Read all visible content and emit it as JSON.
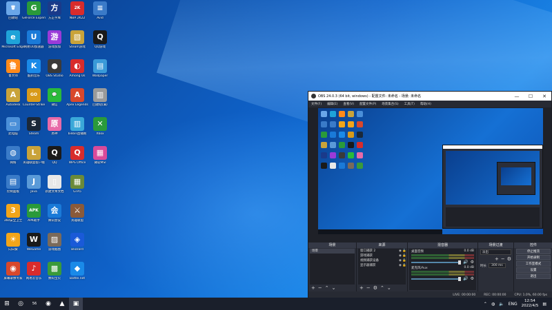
{
  "desktop": {
    "icons": [
      {
        "label": "回收站",
        "glyph": "🗑",
        "color": "#6aa6e8"
      },
      {
        "label": "Microsoft Edge",
        "glyph": "e",
        "color": "#1fa3d8"
      },
      {
        "label": "鲁大师",
        "glyph": "鲁",
        "color": "#ff8a1a"
      },
      {
        "label": "Autodesk",
        "glyph": "A",
        "color": "#c9a33a"
      },
      {
        "label": "此电脑",
        "glyph": "▭",
        "color": "#4a8fd8"
      },
      {
        "label": "网络",
        "glyph": "◍",
        "color": "#3a7bc8"
      },
      {
        "label": "控制面板",
        "glyph": "▤",
        "color": "#3a7bc8"
      },
      {
        "label": "360安全卫士",
        "glyph": "3",
        "color": "#f2a51a"
      },
      {
        "label": "向日葵",
        "glyph": "☀",
        "color": "#f2a51a"
      },
      {
        "label": "屏幕录像专家",
        "glyph": "◉",
        "color": "#d8482c"
      },
      {
        "label": "GeForce Experience",
        "glyph": "G",
        "color": "#2a9a3a"
      },
      {
        "label": "网易UU加速器",
        "glyph": "U",
        "color": "#1a7ad8"
      },
      {
        "label": "酷狗音乐",
        "glyph": "K",
        "color": "#1a8ae8"
      },
      {
        "label": "Counter-Strike",
        "glyph": "GO",
        "color": "#d89a1a"
      },
      {
        "label": "Steam",
        "glyph": "S",
        "color": "#1b2838"
      },
      {
        "label": "英雄联盟客户端",
        "glyph": "L",
        "color": "#c9a33a"
      },
      {
        "label": "Java",
        "glyph": "J",
        "color": "#5a9ad8"
      },
      {
        "label": "APK助手",
        "glyph": "APK",
        "color": "#2a9a3a"
      },
      {
        "label": "WeGame",
        "glyph": "W",
        "color": "#1a1a1a"
      },
      {
        "label": "网易云音乐",
        "glyph": "♪",
        "color": "#d82c2c"
      },
      {
        "label": "方正字库",
        "glyph": "方",
        "color": "#1a3a8a"
      },
      {
        "label": "游戏加加",
        "glyph": "游",
        "color": "#9a3ad8"
      },
      {
        "label": "OBS Studio",
        "glyph": "●",
        "color": "#3a3a3a"
      },
      {
        "label": "微信",
        "glyph": "💬",
        "color": "#2aba3a"
      },
      {
        "label": "原神",
        "glyph": "原",
        "color": "#e86aa8"
      },
      {
        "label": "QQ",
        "glyph": "Q",
        "color": "#1a1a1a"
      },
      {
        "label": "新建文本文档",
        "glyph": "▯",
        "color": "#e8e8e8"
      },
      {
        "label": "腾讯会议",
        "glyph": "会",
        "color": "#1a7ad8"
      },
      {
        "label": "游戏截图",
        "glyph": "▨",
        "color": "#7a6a5a"
      },
      {
        "label": "数码宝贝",
        "glyph": "▩",
        "color": "#3a9a3a"
      },
      {
        "label": "NBA 2K22",
        "glyph": "2K",
        "color": "#d82c2c"
      },
      {
        "label": "Steam游戏",
        "glyph": "▧",
        "color": "#c9a33a"
      },
      {
        "label": "Among Us",
        "glyph": "◐",
        "color": "#d82c2c"
      },
      {
        "label": "Apex Legends",
        "glyph": "A",
        "color": "#d8482c"
      },
      {
        "label": "bilibili直播姬",
        "glyph": "▥",
        "color": "#3aa8d8"
      },
      {
        "label": "WPS Office",
        "glyph": "Q",
        "color": "#d82c2c"
      },
      {
        "label": "GTA5",
        "glyph": "▦",
        "color": "#6a8a3a"
      },
      {
        "label": "英雄联盟",
        "glyph": "⚔",
        "color": "#8a5a3a"
      },
      {
        "label": "Blizzard",
        "glyph": "◈",
        "color": "#1a5ad8"
      },
      {
        "label": "Battle.net",
        "glyph": "◆",
        "color": "#1a8ae8"
      },
      {
        "label": "Avid",
        "glyph": "≡",
        "color": "#3a7ac8"
      },
      {
        "label": "QQ游戏",
        "glyph": "Q",
        "color": "#1a1a1a"
      },
      {
        "label": "Wallpaper",
        "glyph": "▤",
        "color": "#3a9ad8"
      },
      {
        "label": "回收站(满)",
        "glyph": "▥",
        "color": "#9a9a9a"
      },
      {
        "label": "Xbox",
        "glyph": "✕",
        "color": "#2a9a3a"
      },
      {
        "label": "微软MSI",
        "glyph": "▦",
        "color": "#d84a9a"
      }
    ]
  },
  "obs": {
    "title": "OBS 24.0.3 (64 bit, windows) - 配置文件: 未命名 - 场景: 未命名",
    "menu": [
      "文件(F)",
      "编辑(E)",
      "查看(V)",
      "配置文件(P)",
      "场景集合(S)",
      "工具(T)",
      "帮助(H)"
    ],
    "win_buttons": {
      "min": "—",
      "max": "☐",
      "close": "✕"
    },
    "docks": {
      "scenes": {
        "title": "场景",
        "items": [
          "场景"
        ]
      },
      "sources": {
        "title": "来源",
        "items": [
          "窗口捕获 2",
          "游戏捕获",
          "视频捕获设备",
          "显示器捕获"
        ]
      },
      "mixer": {
        "title": "混音器",
        "channels": [
          {
            "name": "桌面音频",
            "db": "0.0 dB"
          },
          {
            "name": "麦克风/Aux",
            "db": "0.0 dB"
          }
        ]
      },
      "transitions": {
        "title": "场景过渡",
        "selected": "淡出",
        "duration_label": "时长",
        "duration_value": "300 ms"
      },
      "controls": {
        "title": "控件",
        "buttons": [
          "停止推流",
          "开始录制",
          "工作室模式",
          "设置",
          "退出"
        ]
      }
    },
    "status": {
      "live": "LIVE: 00:00:00",
      "rec": "REC: 00:00:00",
      "cpu": "CPU: 1.0%, 60.00 fps"
    }
  },
  "taskbar": {
    "items": [
      "⊞",
      "◎",
      "56",
      "◉",
      "▲",
      "▣"
    ],
    "tray": {
      "lang": "ENG",
      "time": "12:54",
      "date": "2022/4/5"
    }
  }
}
